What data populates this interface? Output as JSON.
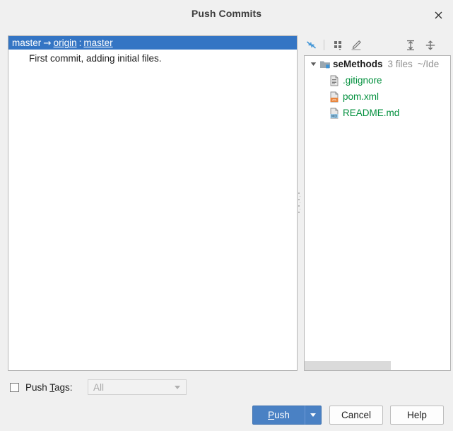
{
  "window": {
    "title": "Push Commits",
    "close_icon": "close-icon"
  },
  "commits": {
    "branch_row": {
      "local_branch": "master",
      "arrow": "→",
      "remote": "origin",
      "separator": ":",
      "remote_branch": "master",
      "selected": true
    },
    "commit_message": "First commit, adding initial files."
  },
  "tree_toolbar": {
    "buttons": [
      {
        "name": "collapse-all-icon",
        "tooltip": "Collapse All"
      },
      {
        "name": "group-by-icon",
        "tooltip": "Group By"
      },
      {
        "name": "edit-source-icon",
        "tooltip": "Edit Source"
      },
      {
        "name": "expand-all-icon",
        "tooltip": "Expand All"
      },
      {
        "name": "split-icon",
        "tooltip": "Split"
      }
    ]
  },
  "file_tree": {
    "root": {
      "name": "seMethods",
      "count": "3 files",
      "path": "~/Ide",
      "expanded": true,
      "icon": "module-folder-icon"
    },
    "files": [
      {
        "name": ".gitignore",
        "icon": "text-file-icon"
      },
      {
        "name": "pom.xml",
        "icon": "xml-file-icon"
      },
      {
        "name": "README.md",
        "icon": "markdown-file-icon"
      }
    ]
  },
  "push_tags": {
    "checked": false,
    "label_prefix": "Push ",
    "label_mnemonic": "T",
    "label_suffix": "ags:",
    "combo_value": "",
    "combo_placeholder": "All",
    "combo_enabled": false
  },
  "buttons": {
    "push_prefix": "",
    "push_mnemonic": "P",
    "push_suffix": "ush",
    "push_dropdown_icon": "chevron-down-icon",
    "cancel": "Cancel",
    "help": "Help"
  },
  "colors": {
    "accent": "#4a81c4",
    "selection": "#3475c4",
    "file_green": "#008f3c",
    "muted": "#919191",
    "dialog_bg": "#f0f0f0"
  }
}
